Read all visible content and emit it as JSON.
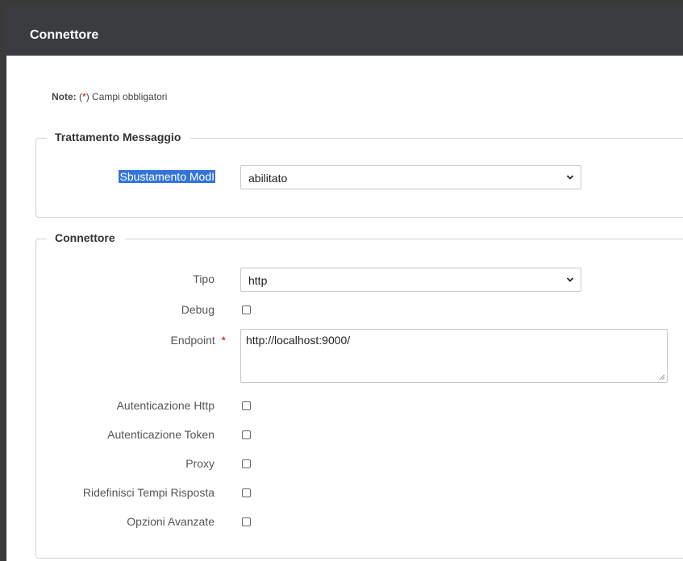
{
  "header": {
    "title": "Connettore"
  },
  "note": {
    "prefix": "Note:",
    "open": "(",
    "star": "*",
    "close": ")",
    "text": " Campi obbligatori"
  },
  "trattamento": {
    "legend": "Trattamento Messaggio",
    "sbustamento_label": "Sbustamento ModI",
    "sbustamento_value": "abilitato"
  },
  "connettore": {
    "legend": "Connettore",
    "tipo_label": "Tipo",
    "tipo_value": "http",
    "debug_label": "Debug",
    "endpoint_label": "Endpoint",
    "endpoint_required": "*",
    "endpoint_value": "http://localhost:9000/",
    "autenticazione_http_label": "Autenticazione Http",
    "autenticazione_token_label": "Autenticazione Token",
    "proxy_label": "Proxy",
    "ridefinisci_label": "Ridefinisci Tempi Risposta",
    "opzioni_label": "Opzioni Avanzate"
  },
  "colors": {
    "header_bg": "#3b3c40",
    "selection": "#3375d6",
    "required": "#cc0000"
  }
}
